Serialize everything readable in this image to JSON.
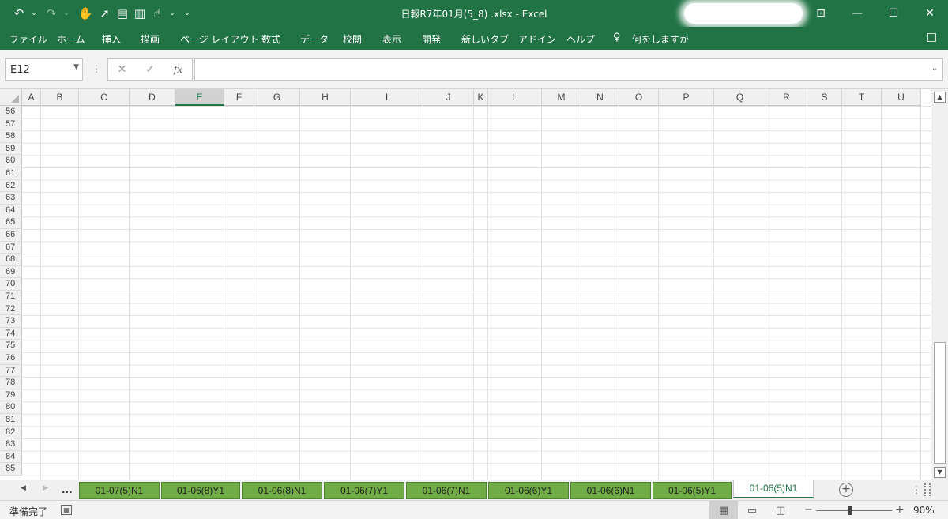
{
  "window": {
    "title": "日報R7年01月(5_8) .xlsx  -  Excel",
    "controls": {
      "ribbon_display": "⊡",
      "minimize": "—",
      "maximize": "☐",
      "close": "✕"
    }
  },
  "quick_access": {
    "undo": "↶",
    "undo_dd": "⌄",
    "redo": "↷",
    "redo_dd": "⌄",
    "touch": "✋",
    "select": "➚",
    "print_preview": "▤",
    "save": "▥",
    "touch_mode": "☝",
    "touch_dd": "⌄",
    "customize": "⌄"
  },
  "ribbon": {
    "tabs": [
      "ファイル",
      "ホーム",
      "挿入",
      "描画",
      "ページ レイアウト",
      "数式",
      "データ",
      "校閲",
      "表示",
      "開発",
      "新しいタブ",
      "アドイン",
      "ヘルプ"
    ],
    "tell_me_icon": "♀",
    "tell_me": "何をしますか",
    "comment_icon": "☐"
  },
  "formula_bar": {
    "name_box": "E12",
    "name_dd": "▼",
    "separator": "⋮",
    "cancel": "✕",
    "enter": "✓",
    "fx": "fx",
    "formula": "",
    "expand": "⌄"
  },
  "grid": {
    "columns": [
      "A",
      "B",
      "C",
      "D",
      "E",
      "F",
      "G",
      "H",
      "I",
      "J",
      "K",
      "L",
      "M",
      "N",
      "O",
      "P",
      "Q",
      "R",
      "S",
      "T",
      "U"
    ],
    "selected_column": "E",
    "rows": [
      "56",
      "57",
      "58",
      "59",
      "60",
      "61",
      "62",
      "63",
      "64",
      "65",
      "66",
      "67",
      "68",
      "69",
      "70",
      "71",
      "72",
      "73",
      "74",
      "75",
      "76",
      "77",
      "78",
      "79",
      "80",
      "81",
      "82",
      "83",
      "84",
      "85"
    ]
  },
  "scrollbar": {
    "up": "▲",
    "down": "▼"
  },
  "sheet_tabs": {
    "prev": "◀",
    "next": "▶",
    "more": "...",
    "tabs": [
      "01-07(5)N1",
      "01-06(8)Y1",
      "01-06(8)N1",
      "01-06(7)Y1",
      "01-06(7)N1",
      "01-06(6)Y1",
      "01-06(6)N1",
      "01-06(5)Y1",
      "01-06(5)N1"
    ],
    "active": "01-06(5)N1",
    "add": "+",
    "overflow": "⋮"
  },
  "status_bar": {
    "status": "準備完了",
    "macro_icon": "▦",
    "view_normal": "▦",
    "view_page_layout": "▭",
    "view_page_break": "◫",
    "zoom_minus": "−",
    "zoom_plus": "+",
    "zoom_level": "90%"
  }
}
